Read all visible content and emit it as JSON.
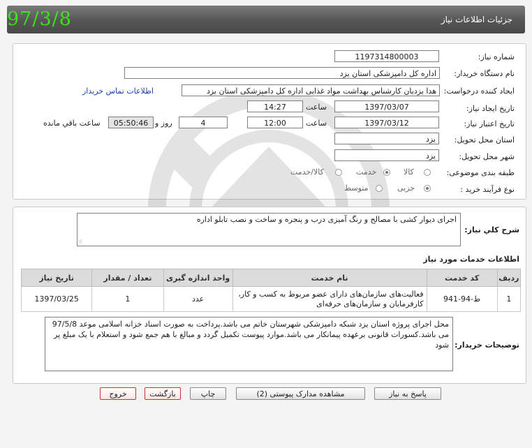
{
  "header": {
    "title": "جزئیات اطلاعات نیاز",
    "stamp": "97/3/8"
  },
  "form": {
    "need_number_label": "شماره نیاز:",
    "need_number": "1197314800003",
    "buyer_org_label": "نام دستگاه خریدار:",
    "buyer_org": "اداره کل دامپزشکی استان یزد",
    "creator_label": "ایجاد کننده درخواست:",
    "creator": "هدا یزدیان کارشناس بهداشت مواد غذایی اداره کل دامپزشکی استان یزد",
    "contact_link": "اطلاعات تماس خریدار",
    "created_label": "تاریخ ایجاد نیاز:",
    "created_date": "1397/03/07",
    "time_label": "ساعت",
    "created_time": "14:27",
    "valid_label": "تاریخ اعتبار نیاز:",
    "valid_date": "1397/03/12",
    "valid_time_label": "ساعت",
    "valid_time": "12:00",
    "days": "4",
    "days_label": "روز و",
    "remaining": "05:50:46",
    "remaining_label": "ساعت باقي مانده",
    "province_label": "استان محل تحویل:",
    "province": "یزد",
    "city_label": "شهر محل تحویل:",
    "city": "یزد",
    "category_label": "طبقه بندی موضوعی:",
    "category_options": [
      "کالا",
      "خدمت",
      "کالا/خدمت"
    ],
    "category_selected": "خدمت",
    "process_label": "نوع فرآیند خرید :",
    "process_options": [
      "جزیی",
      "متوسط"
    ],
    "process_selected": "جزیی"
  },
  "description": {
    "label": "شرح کلي نیاز:",
    "text": "اجرای دیوار کشی با مصالح و رنگ آمیزی درب و پنجره و ساخت و نصب تابلو اداره"
  },
  "services": {
    "section_title": "اطلاعات خدمات مورد نیاز",
    "columns": [
      "ردیف",
      "کد خدمت",
      "نام خدمت",
      "واحد اندازه گیری",
      "تعداد / مقدار",
      "تاریخ نیاز"
    ],
    "rows": [
      {
        "row": "1",
        "code": "ط-94-941",
        "name": "فعالیت‌های سازمان‌های دارای عضو مربوط به کسب و کار، کارفرمایان و سازمان‌های حرفه‌ای",
        "unit": "عدد",
        "qty": "1",
        "date": "1397/03/25"
      }
    ]
  },
  "buyer_notes": {
    "label": "توضیحات خریدار:",
    "text": "محل اجرای پروژه استان یزد شبکه دامپزشکی شهرستان خاتم می باشد.پرداخت به صورت اسناد خزانه اسلامی موعد 97/5/8 می باشد.کسورات قانونی برعهده پیمانکار می باشد.موارد پیوست تکمیل گردد و مبالغ با هم جمع شود و استعلام با یک مبلغ پر شود"
  },
  "buttons": {
    "reply": "پاسخ به نیاز",
    "attachments": "مشاهده مدارک پیوستی (2)",
    "print": "چاپ",
    "back": "بازگشت",
    "exit": "خروج"
  },
  "colors": {
    "stamp": "#39e61a",
    "link": "#1a3fb4",
    "exit_border": "#cc3333"
  }
}
